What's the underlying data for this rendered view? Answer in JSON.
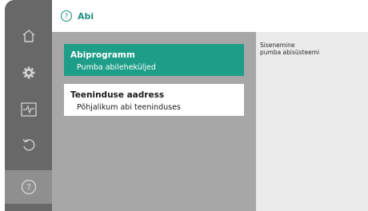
{
  "header": {
    "title": "Abi",
    "icon": "help-circle-icon"
  },
  "sidebar": {
    "items": [
      {
        "name": "home",
        "icon": "home-icon",
        "active": false
      },
      {
        "name": "settings",
        "icon": "gear-icon",
        "active": false
      },
      {
        "name": "diagnostics",
        "icon": "pulse-monitor-icon",
        "active": false
      },
      {
        "name": "reset",
        "icon": "undo-icon",
        "active": false
      },
      {
        "name": "help",
        "icon": "help-circle-icon",
        "active": true
      }
    ]
  },
  "menu": [
    {
      "title": "Abiprogramm",
      "subtitle": "Pumba abileheküljed",
      "selected": true
    },
    {
      "title": "Teeninduse aadress",
      "subtitle": "Põhjalikum abi teeninduses",
      "selected": false
    }
  ],
  "info": {
    "line1": "Sisenemine",
    "line2": "pumba abisüsteemi"
  },
  "colors": {
    "accent": "#1e9d89",
    "title_text": "#1f8f83",
    "sidebar": "#686868",
    "content_bg": "#a7a7a7"
  }
}
